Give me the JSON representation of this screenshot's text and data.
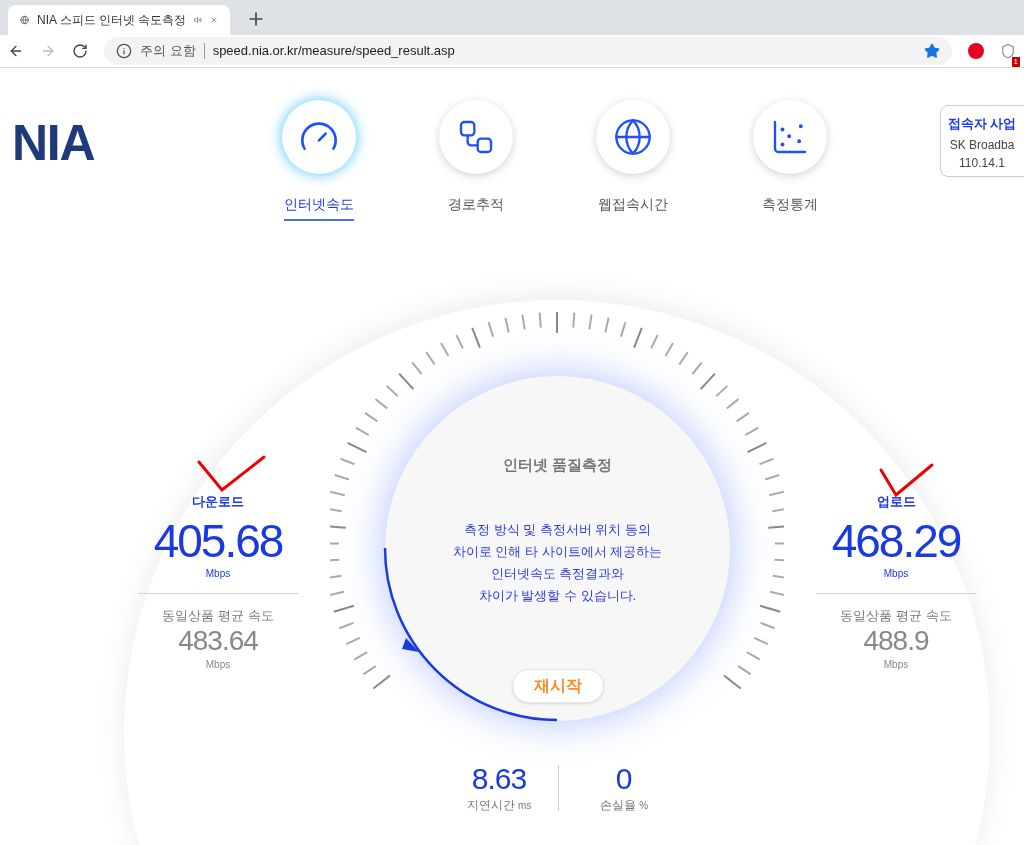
{
  "browser": {
    "tab_title": "NIA 스피드 인터넷 속도측정",
    "security_label": "주의 요함",
    "url": "speed.nia.or.kr/measure/speed_result.asp",
    "extension_badge": "1"
  },
  "logo": "NIA",
  "nav": [
    {
      "label": "인터넷속도",
      "selected": true,
      "kind": "gauge"
    },
    {
      "label": "경로추적",
      "selected": false,
      "kind": "route"
    },
    {
      "label": "웹접속시간",
      "selected": false,
      "kind": "globe"
    },
    {
      "label": "측정통계",
      "selected": false,
      "kind": "stats"
    }
  ],
  "connection_card": {
    "title": "접속자 사업",
    "isp": "SK Broadba",
    "ip": "110.14.1"
  },
  "gauge": {
    "title": "인터넷 품질측정",
    "notice_lines": [
      "측정 방식 및 측정서버 위치 등의",
      "차이로 인해 타 사이트에서 제공하는",
      "인터넷속도 측정결과와",
      "차이가 발생할 수 있습니다."
    ],
    "restart_button": "재시작"
  },
  "download": {
    "label": "다운로드",
    "value": "405.68",
    "unit": "Mbps",
    "average_label": "동일상품 평균 속도",
    "average_value": "483.64",
    "average_unit": "Mbps"
  },
  "upload": {
    "label": "업로드",
    "value": "468.29",
    "unit": "Mbps",
    "average_label": "동일상품 평균 속도",
    "average_value": "488.9",
    "average_unit": "Mbps"
  },
  "latency": {
    "value": "8.63",
    "label": "지연시간",
    "unit": "ms"
  },
  "loss": {
    "value": "0",
    "label": "손실율",
    "unit": "%"
  }
}
